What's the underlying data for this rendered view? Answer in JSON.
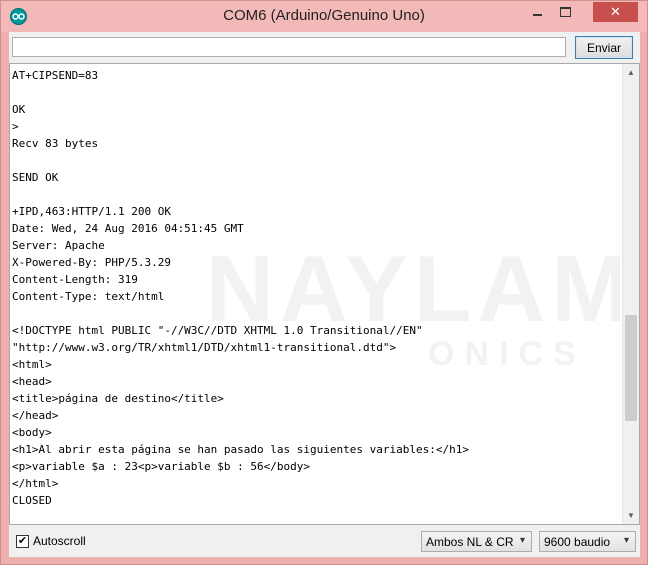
{
  "window": {
    "title": "COM6 (Arduino/Genuino Uno)",
    "close_glyph": "✕"
  },
  "toolbar": {
    "input_value": "",
    "send_label": "Enviar"
  },
  "output": {
    "lines": [
      "AT+CIPSEND=83",
      "",
      "OK",
      ">",
      "Recv 83 bytes",
      "",
      "SEND OK",
      "",
      "+IPD,463:HTTP/1.1 200 OK",
      "Date: Wed, 24 Aug 2016 04:51:45 GMT",
      "Server: Apache",
      "X-Powered-By: PHP/5.3.29",
      "Content-Length: 319",
      "Content-Type: text/html",
      "",
      "<!DOCTYPE html PUBLIC \"-//W3C//DTD XHTML 1.0 Transitional//EN\"",
      "\"http://www.w3.org/TR/xhtml1/DTD/xhtml1-transitional.dtd\">",
      "<html>",
      "<head>",
      "<title>página de destino</title>",
      "</head>",
      "<body>",
      "<h1>Al abrir esta página se han pasado las siguientes variables:</h1>",
      "<p>variable $a : 23<p>variable $b : 56</body>",
      "</html>",
      "CLOSED"
    ],
    "watermark_main": "NAYLAMP",
    "watermark_sub": "ONICS",
    "scroll_up_glyph": "▲",
    "scroll_down_glyph": "▼",
    "scroll_position": 0.73
  },
  "footer": {
    "autoscroll_label": "Autoscroll",
    "autoscroll_checked": true,
    "check_glyph": "✔",
    "line_ending": "Ambos NL & CR",
    "baud_rate": "9600 baudio",
    "dropdown_glyph": "▾"
  },
  "icons": {
    "app": "arduino-infinity-icon",
    "minimize": "minimize-icon",
    "maximize": "maximize-icon",
    "close": "close-icon",
    "check": "check-icon",
    "dropdown": "chevron-down-icon"
  },
  "colors": {
    "title_bar": "#f3b9b8",
    "close_button": "#c7504c",
    "arduino_teal": "#00979c",
    "send_button_border": "#3c7fb1"
  }
}
